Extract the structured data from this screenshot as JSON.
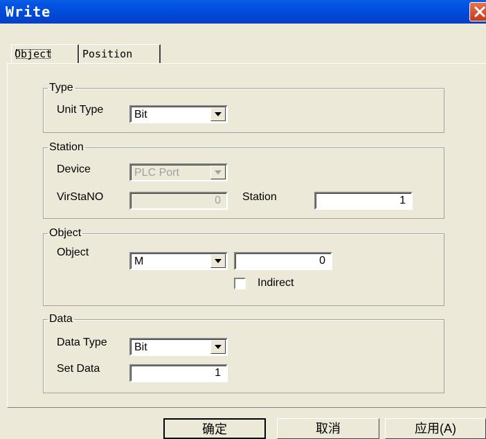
{
  "window": {
    "title": "Write"
  },
  "tabs": [
    {
      "label": "Object"
    },
    {
      "label": "Position"
    }
  ],
  "type_group": {
    "legend": "Type",
    "unit_type_label": "Unit Type",
    "unit_type_value": "Bit"
  },
  "station_group": {
    "legend": "Station",
    "device_label": "Device",
    "device_value": "PLC Port",
    "virstano_label": "VirStaNO",
    "virstano_value": "0",
    "station_label": "Station",
    "station_value": "1"
  },
  "object_group": {
    "legend": "Object",
    "object_label": "Object",
    "object_value": "M",
    "address_value": "0",
    "indirect_label": "Indirect"
  },
  "data_group": {
    "legend": "Data",
    "data_type_label": "Data Type",
    "data_type_value": "Bit",
    "set_data_label": "Set Data",
    "set_data_value": "1"
  },
  "buttons": {
    "ok": "确定",
    "cancel": "取消",
    "apply": "应用(A)"
  }
}
